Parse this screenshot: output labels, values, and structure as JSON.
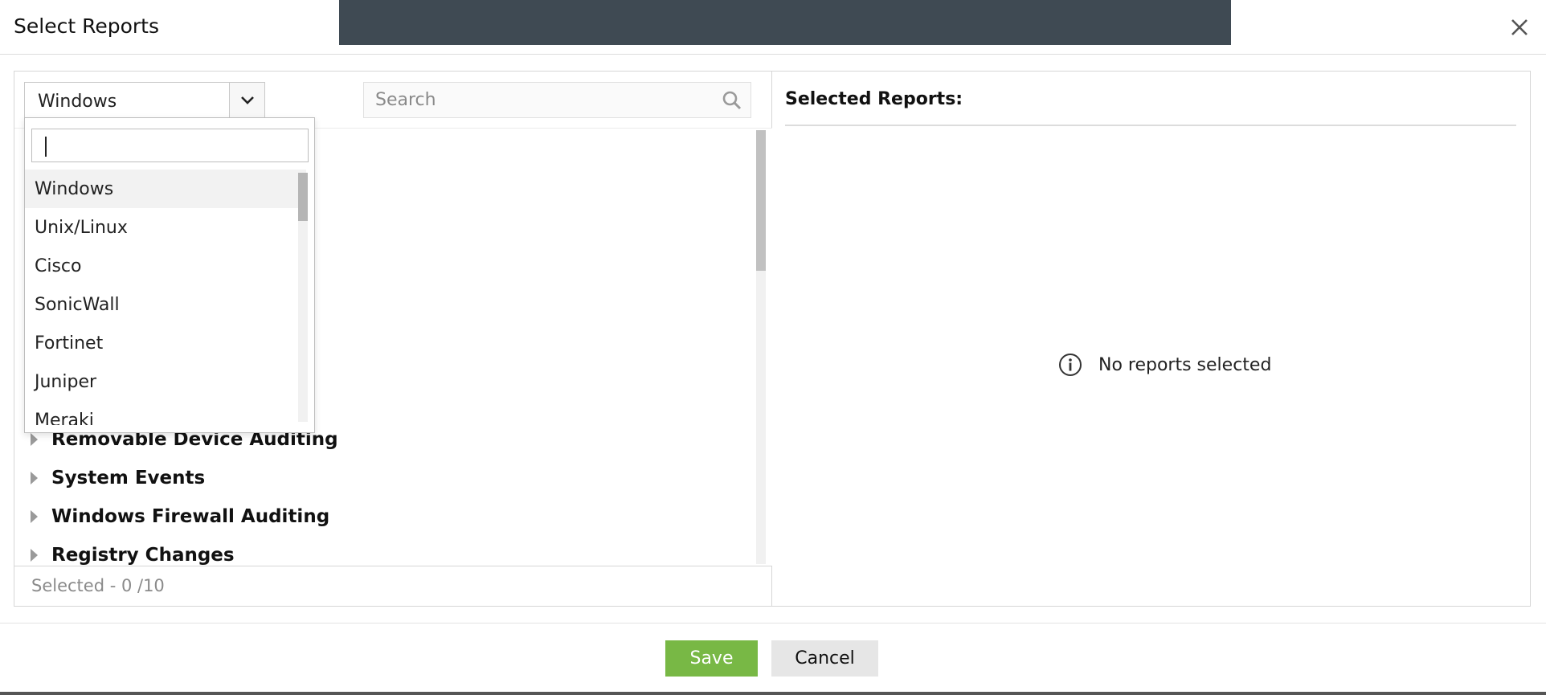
{
  "dialog": {
    "title": "Select Reports"
  },
  "left": {
    "category_select": {
      "value": "Windows",
      "options": [
        "Windows",
        "Unix/Linux",
        "Cisco",
        "SonicWall",
        "Fortinet",
        "Juniper",
        "Meraki"
      ],
      "filter_value": ""
    },
    "search": {
      "placeholder": "Search"
    },
    "tree_items": [
      "Removable Device Auditing",
      "System Events",
      "Windows Firewall Auditing",
      "Registry Changes"
    ],
    "selected_count": "Selected - 0 /10"
  },
  "right": {
    "title": "Selected Reports:",
    "empty_message": "No reports selected"
  },
  "buttons": {
    "save": "Save",
    "cancel": "Cancel"
  },
  "colors": {
    "save_button": "#78b845",
    "header_bar": "#3f4a53"
  },
  "icons": [
    "close-icon",
    "chevron-down-icon",
    "search-icon",
    "caret-right-icon",
    "info-icon"
  ]
}
